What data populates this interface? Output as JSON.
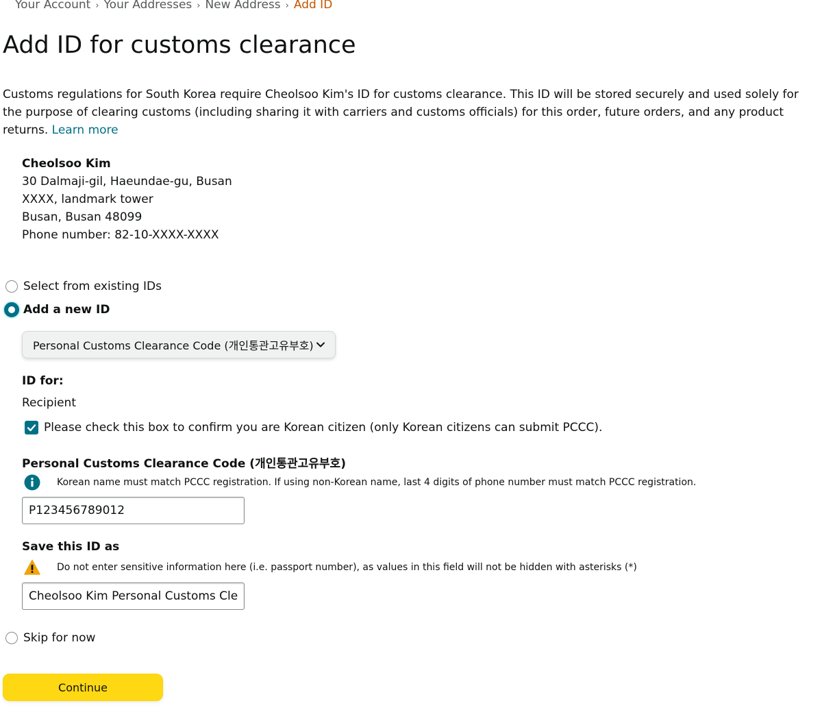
{
  "breadcrumb": {
    "items": [
      "Your Account",
      "Your Addresses",
      "New Address"
    ],
    "current": "Add ID"
  },
  "page_title": "Add ID for customs clearance",
  "intro": {
    "text": "Customs regulations for South Korea require Cheolsoo Kim's ID for customs clearance. This ID will be stored securely and used solely for the purpose of clearing customs (including sharing it with carriers and customs officials) for this order, future orders, and any product returns. ",
    "learn_more": "Learn more"
  },
  "address": {
    "name": "Cheolsoo Kim",
    "line1": "30 Dalmaji-gil, Haeundae-gu, Busan",
    "line2": "XXXX, landmark tower",
    "line3": "Busan, Busan 48099",
    "phone": "Phone number: 82-10-XXXX-XXXX"
  },
  "options": {
    "existing": "Select from existing IDs",
    "add_new": "Add a new ID",
    "skip": "Skip for now",
    "selected": "add_new"
  },
  "id_type_dropdown": {
    "selected": "Personal Customs Clearance Code (개인통관고유부호)"
  },
  "id_for": {
    "label": "ID for:",
    "value": "Recipient"
  },
  "citizen_checkbox": {
    "label": "Please check this box to confirm you are Korean citizen (only Korean citizens can submit PCCC).",
    "checked": true
  },
  "pccc": {
    "label": "Personal Customs Clearance Code (개인통관고유부호)",
    "info": "Korean name must match PCCC registration. If using non-Korean name, last 4 digits of phone number must match PCCC registration.",
    "value": "P123456789012"
  },
  "save_as": {
    "label": "Save this ID as",
    "warning": "Do not enter sensitive information here (i.e. passport number), as values in this field will not be hidden with asterisks (*)",
    "value": "Cheolsoo Kim Personal Customs Clea"
  },
  "continue_label": "Continue",
  "colors": {
    "link": "#007185",
    "breadcrumb_current": "#c45500",
    "button": "#ffd814",
    "warning": "#f0a30a",
    "radio_checked": "#007185"
  },
  "icons": {
    "info": "info-icon",
    "warning": "warning-icon",
    "dropdown": "chevron-down-icon",
    "checkbox": "checkmark-icon"
  }
}
